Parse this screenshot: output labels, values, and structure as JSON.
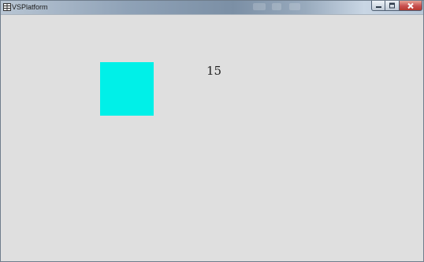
{
  "window": {
    "title": "VSPlatform",
    "app_icon": "window-grid-icon",
    "controls": {
      "minimize_icon": "minimize-icon",
      "maximize_icon": "maximize-icon",
      "close_icon": "close-icon"
    }
  },
  "canvas": {
    "background_color": "#dfdfdf",
    "square": {
      "color": "#00f0e8"
    },
    "value_label": "15"
  }
}
